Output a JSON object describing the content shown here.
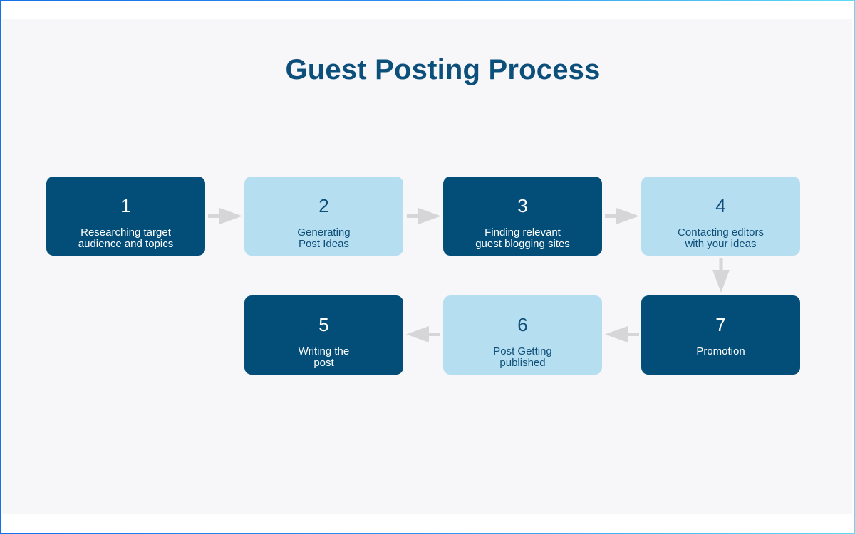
{
  "title": "Guest Posting Process",
  "colors": {
    "dark_box": "#034e79",
    "light_box": "#b5dff1",
    "title": "#0b4f7a",
    "arrow": "#d6d6d8",
    "canvas": "#f7f7fa"
  },
  "steps": [
    {
      "number": "1",
      "label": "Researching target\naudience and topics",
      "style": "dark"
    },
    {
      "number": "2",
      "label": "Generating\nPost Ideas",
      "style": "light"
    },
    {
      "number": "3",
      "label": "Finding relevant\nguest blogging sites",
      "style": "dark"
    },
    {
      "number": "4",
      "label": "Contacting editors\nwith your ideas",
      "style": "light"
    },
    {
      "number": "5",
      "label": "Writing the\npost",
      "style": "dark"
    },
    {
      "number": "6",
      "label": "Post Getting\npublished",
      "style": "light"
    },
    {
      "number": "7",
      "label": "Promotion",
      "style": "dark"
    }
  ],
  "flow": [
    {
      "from": "1",
      "to": "2",
      "direction": "right"
    },
    {
      "from": "2",
      "to": "3",
      "direction": "right"
    },
    {
      "from": "3",
      "to": "4",
      "direction": "right"
    },
    {
      "from": "4",
      "to": "7",
      "direction": "down"
    },
    {
      "from": "7",
      "to": "6",
      "direction": "left"
    },
    {
      "from": "6",
      "to": "5",
      "direction": "left"
    }
  ]
}
